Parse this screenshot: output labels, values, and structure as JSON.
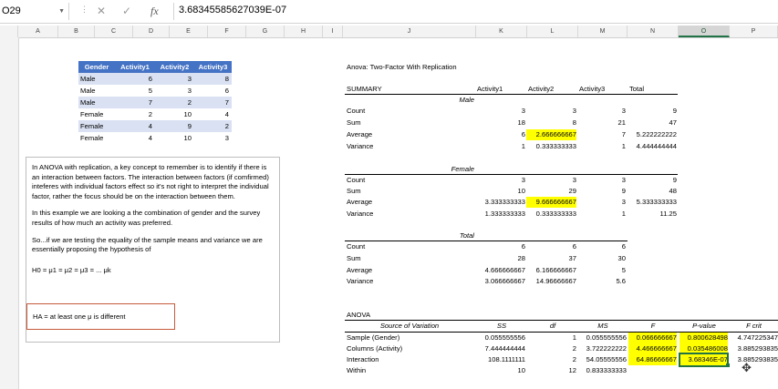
{
  "formula_bar": {
    "name_box": "O29",
    "formula": "3.68345585627039E-07",
    "fx_label": "fx"
  },
  "columns": [
    "A",
    "B",
    "C",
    "D",
    "E",
    "F",
    "G",
    "H",
    "I",
    "J",
    "K",
    "L",
    "M",
    "N",
    "O",
    "P"
  ],
  "selected_column": "O",
  "gender_table": {
    "headers": [
      "Gender",
      "Activity1",
      "Activity2",
      "Activity3"
    ],
    "rows": [
      [
        "Male",
        "6",
        "3",
        "8"
      ],
      [
        "Male",
        "5",
        "3",
        "6"
      ],
      [
        "Male",
        "7",
        "2",
        "7"
      ],
      [
        "Female",
        "2",
        "10",
        "4"
      ],
      [
        "Female",
        "4",
        "9",
        "2"
      ],
      [
        "Female",
        "4",
        "10",
        "3"
      ]
    ]
  },
  "textbox": {
    "para1": "In ANOVA with replication, a key concept to remember is to identify if there is an interaction between factors. The interaction between factors (if comfirmed) inteferes with individual factors effect so it's not right to interpret the individual factor, rather the focus should be on the interaction between them.",
    "para2": "In this example we are looking a the combination of gender and the survey results of how much an activity was preferred.",
    "para3": "So...if we are testing the equality of the sample means and variance we are essentially proposing the hypothesis of",
    "h0": "H0 = μ1 = μ2 = μ3 = ... μk",
    "ha": "HA = at least one μ is different"
  },
  "anova": {
    "title": "Anova: Two-Factor With Replication",
    "summary_label": "SUMMARY",
    "summary_cols": [
      "Activity1",
      "Activity2",
      "Activity3",
      "Total"
    ],
    "male": {
      "label": "Male",
      "rows": [
        [
          "Count",
          "3",
          "3",
          "3",
          "9"
        ],
        [
          "Sum",
          "18",
          "8",
          "21",
          "47"
        ],
        [
          "Average",
          "6",
          "2.666666667",
          "7",
          "5.222222222"
        ],
        [
          "Variance",
          "1",
          "0.333333333",
          "1",
          "4.444444444"
        ]
      ]
    },
    "female": {
      "label": "Female",
      "rows": [
        [
          "Count",
          "3",
          "3",
          "3",
          "9"
        ],
        [
          "Sum",
          "10",
          "29",
          "9",
          "48"
        ],
        [
          "Average",
          "3.333333333",
          "9.666666667",
          "3",
          "5.333333333"
        ],
        [
          "Variance",
          "1.333333333",
          "0.333333333",
          "1",
          "11.25"
        ]
      ]
    },
    "total": {
      "label": "Total",
      "rows": [
        [
          "Count",
          "6",
          "6",
          "6"
        ],
        [
          "Sum",
          "28",
          "37",
          "30"
        ],
        [
          "Average",
          "4.666666667",
          "6.166666667",
          "5"
        ],
        [
          "Variance",
          "3.066666667",
          "14.96666667",
          "5.6"
        ]
      ]
    },
    "table_label": "ANOVA",
    "table_cols": [
      "Source of Variation",
      "SS",
      "df",
      "MS",
      "F",
      "P-value",
      "F crit"
    ],
    "table_rows": [
      [
        "Sample (Gender)",
        "0.055555556",
        "1",
        "0.055555556",
        "0.066666667",
        "0.800628498",
        "4.747225347"
      ],
      [
        "Columns (Activity)",
        "7.444444444",
        "2",
        "3.722222222",
        "4.466666667",
        "0.035486008",
        "3.885293835"
      ],
      [
        "Interaction",
        "108.1111111",
        "2",
        "54.05555556",
        "64.86666667",
        "3.68346E-07",
        "3.885293835"
      ],
      [
        "Within",
        "10",
        "12",
        "0.833333333",
        "",
        "",
        ""
      ]
    ]
  },
  "colors": {
    "header_blue": "#4472c4",
    "row_band": "#d9e1f2",
    "highlight": "#ffff00",
    "excel_green": "#217346",
    "hyp_border": "#c55a3a"
  }
}
